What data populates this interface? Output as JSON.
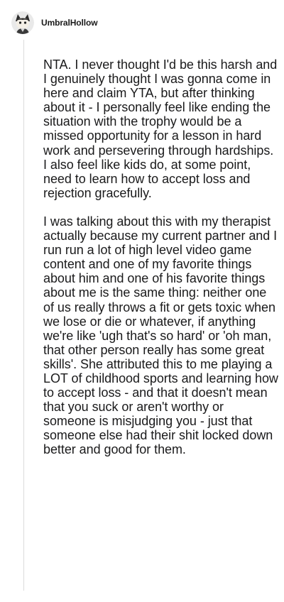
{
  "comment": {
    "username": "UmbralHollow",
    "avatar_icon": "cartoon-character-avatar-icon",
    "paragraphs": [
      "NTA. I never thought I'd be this harsh and I genuinely thought I was gonna come in here and claim YTA, but after thinking about it - I personally feel like ending the situation with the trophy would be a missed opportunity for a lesson in hard work and persevering through hardships. I also feel like kids do, at some point, need to learn how to accept loss and rejection gracefully.",
      "I was talking about this with my therapist actually because my current partner and I run run a lot of high level video game content and one of my favorite things about him and one of his favorite things about me is the same thing: neither one of us really throws a fit or gets toxic when we lose or die or whatever, if anything we're like 'ugh that's so hard' or 'oh man, that other person really has some great skills'. She attributed this to me playing a LOT of childhood sports and learning how to accept loss - and that it doesn't mean that you suck or aren't worthy or someone is misjudging you - just that someone else had their shit locked down better and good for them."
    ]
  }
}
